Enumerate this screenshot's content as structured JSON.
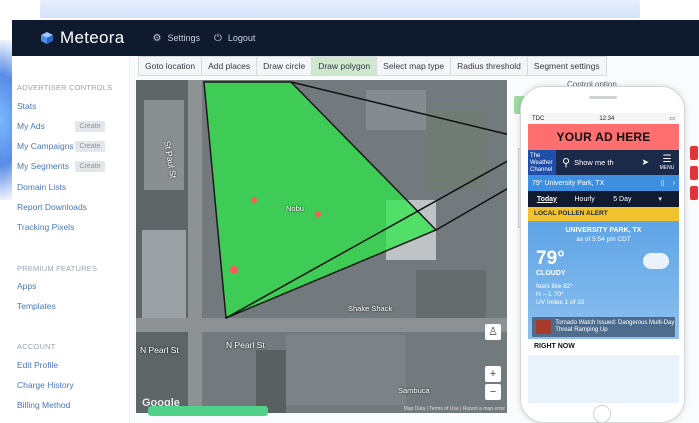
{
  "app": {
    "brand": "Meteora"
  },
  "topnav": [
    {
      "label": "Settings",
      "icon": "gear-icon"
    },
    {
      "label": "Logout",
      "icon": "power-icon"
    }
  ],
  "sidebar": {
    "advertiser_title": "ADVERTISER CONTROLS",
    "stats": "Stats",
    "my_ads": "My Ads",
    "my_campaigns": "My Campaigns",
    "my_segments": "My Segments",
    "create": "Create",
    "domain_lists": "Domain Lists",
    "report_downloads": "Report Downloads",
    "tracking_pixels": "Tracking Pixels",
    "premium_title": "PREMIUM FEATURES",
    "apps": "Apps",
    "templates": "Templates",
    "account_title": "ACCOUNT",
    "edit_profile": "Edit Profile",
    "charge_history": "Charge History",
    "billing_method": "Billing Method"
  },
  "toolbar": [
    {
      "label": "Goto location"
    },
    {
      "label": "Add places"
    },
    {
      "label": "Draw circle"
    },
    {
      "label": "Draw polygon",
      "active": true
    },
    {
      "label": "Select map type"
    },
    {
      "label": "Radius threshold"
    },
    {
      "label": "Segment settings"
    }
  ],
  "map": {
    "streets": [
      "N Pearl St",
      "N Pearl St",
      "St Paul St"
    ],
    "pois": [
      "Nobu",
      "Shake Shack",
      "Sambuca"
    ],
    "google": "Google",
    "attribution": "Map Data | Terms of Use | Report a map error"
  },
  "panel": {
    "title": "Control option"
  },
  "phone": {
    "carrier": "TDC",
    "time": "12:34",
    "ad_text": "YOUR AD HERE",
    "wc_logo": "The Weather Channel",
    "search_placeholder": "Show me th",
    "menu": "MENU",
    "location_row": "79° University Park, TX",
    "tabs": [
      "Today",
      "Hourly",
      "5 Day"
    ],
    "alert": "LOCAL POLLEN ALERT",
    "place": "UNIVERSITY PARK, TX",
    "asof": "as of 5:54 pm CDT",
    "temp": "79°",
    "condition": "CLOUDY",
    "feels": "feels like 82°",
    "hilo": "H -- L 70°",
    "uv": "UV Index 1 of 10",
    "news": "Tornado Watch Issued: Dangerous Multi-Day Threat Ramping Up",
    "right_now": "RIGHT NOW"
  },
  "colors": {
    "topbar": "#0f1a2e",
    "polygon": "#2ee84a",
    "ad": "#ff6f6f",
    "alert": "#f2c12e"
  }
}
